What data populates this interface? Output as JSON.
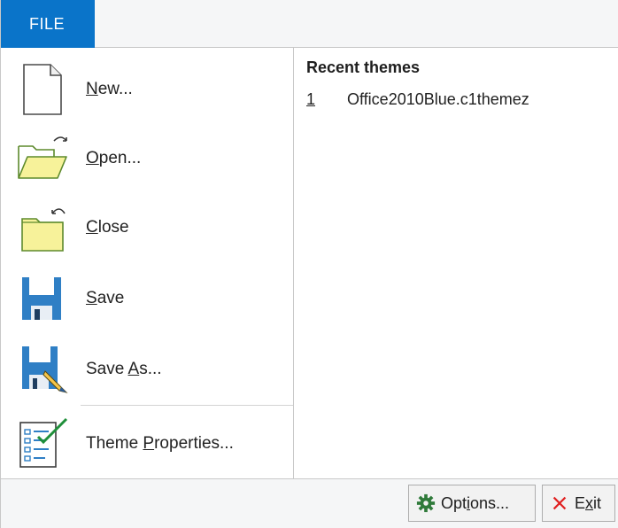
{
  "tab": {
    "file_label": "FILE"
  },
  "menu": {
    "items": [
      {
        "pre": "",
        "key": "N",
        "post": "ew...",
        "icon": "new-document-icon"
      },
      {
        "pre": "",
        "key": "O",
        "post": "pen...",
        "icon": "open-folder-icon"
      },
      {
        "pre": "",
        "key": "C",
        "post": "lose",
        "icon": "close-folder-icon"
      },
      {
        "pre": "",
        "key": "S",
        "post": "ave",
        "icon": "save-disk-icon"
      },
      {
        "pre": "Save ",
        "key": "A",
        "post": "s...",
        "icon": "save-as-icon"
      },
      {
        "pre": "Theme ",
        "key": "P",
        "post": "roperties...",
        "icon": "theme-properties-icon"
      }
    ]
  },
  "recent": {
    "title": "Recent themes",
    "items": [
      {
        "num": "1",
        "name": "Office2010Blue.c1themez"
      }
    ]
  },
  "footer": {
    "options": {
      "pre": "Opt",
      "key": "i",
      "post": "ons...",
      "icon": "gear-icon"
    },
    "exit": {
      "pre": "E",
      "key": "x",
      "post": "it",
      "icon": "close-x-icon"
    }
  },
  "colors": {
    "accent": "#0a74c9",
    "folder": "#f7f29a",
    "folder_stroke": "#5d8a2c",
    "disk": "#2f7fc5",
    "exit_x": "#e02020",
    "gear": "#2f7a3a"
  }
}
